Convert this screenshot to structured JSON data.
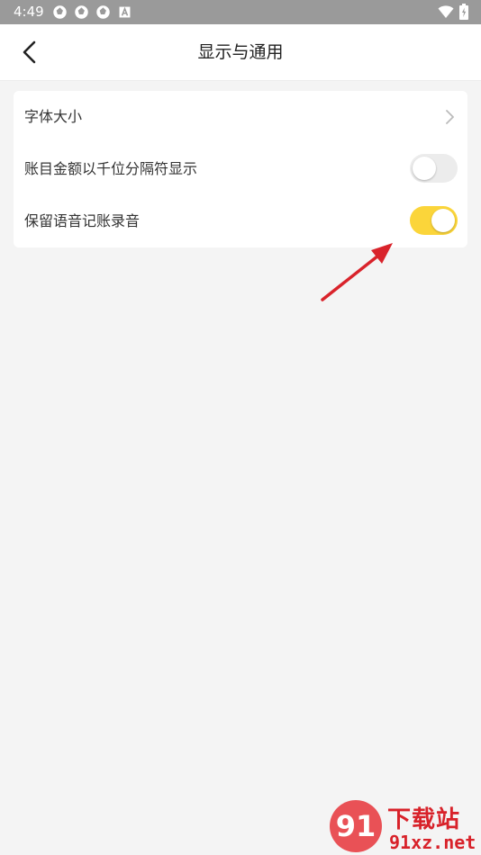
{
  "status_bar": {
    "time": "4:49",
    "notification_icons": [
      "aperture-icon",
      "aperture-icon",
      "aperture-icon",
      "a-box-icon"
    ],
    "right_icons": [
      "wifi-icon",
      "battery-charging-icon"
    ]
  },
  "header": {
    "title": "显示与通用",
    "back_icon": "chevron-left-icon"
  },
  "settings": {
    "font_size": {
      "label": "字体大小",
      "icon": "chevron-right-icon"
    },
    "thousand_separator": {
      "label": "账目金额以千位分隔符显示",
      "enabled": false
    },
    "keep_voice_recording": {
      "label": "保留语音记账录音",
      "enabled": true
    }
  },
  "colors": {
    "toggle_on": "#fbd53a",
    "toggle_off": "#ececec",
    "annotation_arrow": "#d9232b",
    "background": "#f4f4f4"
  },
  "watermark": {
    "logo_text": "91",
    "title": "下载站",
    "url": "91xz.net"
  }
}
